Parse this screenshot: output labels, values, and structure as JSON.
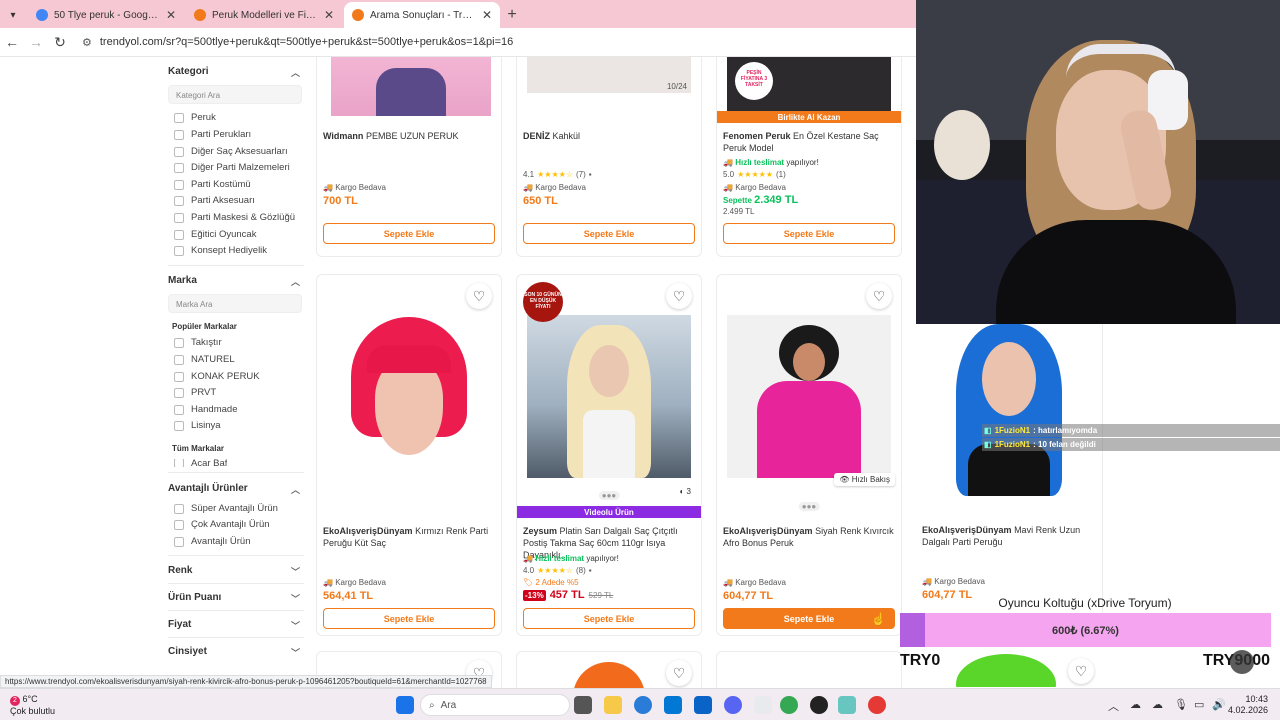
{
  "browser": {
    "tabs": [
      {
        "title": "50 Tlye peruk - Google'da Ara",
        "favicon_color": "#4285f4",
        "active": false
      },
      {
        "title": "Peruk Modelleri ve Fiyatları - Tr",
        "favicon_color": "#f27a1a",
        "active": false
      },
      {
        "title": "Arama Sonuçları - Trendyol",
        "favicon_color": "#f27a1a",
        "active": true
      }
    ],
    "new_tab": "+",
    "url": "trendyol.com/sr?q=500tlye+peruk&qt=500tlye+peruk&st=500tlye+peruk&os=1&pi=16"
  },
  "sidebar": {
    "kategori": {
      "title": "Kategori",
      "search_placeholder": "Kategori Ara",
      "items": [
        "Peruk",
        "Parti Perukları",
        "Diğer Saç Aksesuarları",
        "Diğer Parti Malzemeleri",
        "Parti Kostümü",
        "Parti Aksesuarı",
        "Parti Maskesi & Gözlüğü",
        "Eğitici Oyuncak",
        "Konsept Hediyelik"
      ]
    },
    "marka": {
      "title": "Marka",
      "search_placeholder": "Marka Ara",
      "popular_label": "Popüler Markalar",
      "popular": [
        "Takıştır",
        "NATUREL",
        "KONAK PERUK",
        "PRVT",
        "Handmade",
        "Lisinya"
      ],
      "all_label": "Tüm Markalar",
      "all_partial": "Acar Baf"
    },
    "avantajli": {
      "title": "Avantajlı Ürünler",
      "items": [
        "Süper Avantajlı Ürün",
        "Çok Avantajlı Ürün",
        "Avantajlı Ürün"
      ]
    },
    "collapsed": [
      "Renk",
      "Ürün Puanı",
      "Fiyat",
      "Cinsiyet"
    ]
  },
  "products_row1": [
    {
      "brand": "Widmann",
      "name": "PEMBE UZUN PERUK",
      "shipping": "Kargo Bedava",
      "price": "700 TL",
      "button": "Sepete Ekle"
    },
    {
      "brand": "DENİZ",
      "name": "Kahkül",
      "rating": "4.1",
      "reviews": "(7)",
      "shipping": "Kargo Bedava",
      "price": "650 TL",
      "button": "Sepete Ekle",
      "counter": "10/24"
    },
    {
      "brand": "Fenomen Peruk",
      "name": "En Özel Kestane Saç Peruk Model",
      "band": "Birlikte Al Kazan",
      "fast": "Hızlı teslimat",
      "fast_suffix": "yapılıyor!",
      "rating": "5.0",
      "reviews": "(1)",
      "shipping": "Kargo Bedava",
      "basket_label": "Sepette",
      "price": "2.349 TL",
      "old_price": "2.499 TL",
      "button": "Sepete Ekle",
      "badge": "PEŞİN FİYATINA 3 TAKSİT"
    }
  ],
  "products_row2": [
    {
      "brand": "EkoAlışverişDünyam",
      "name": "Kırmızı Renk Parti Peruğu Küt Saç",
      "shipping": "Kargo Bedava",
      "price": "564,41 TL",
      "button": "Sepete Ekle"
    },
    {
      "brand": "Zeysum",
      "name": "Platin Sarı Dalgalı Saç Çıtçıtlı Postiş Takma Saç 60cm 110gr Isıya Dayanıklı...",
      "band": "Videolu Ürün",
      "fast": "Hızlı teslimat",
      "fast_suffix": "yapılıyor!",
      "rating": "4.0",
      "reviews": "(8)",
      "promo": "2 Adede %5",
      "discount": "-13%",
      "price": "457 TL",
      "old_price": "529 TL",
      "button": "Sepete Ekle",
      "badge": "SON 10 GÜNÜN EN DÜŞÜK FİYATI",
      "img_count": "3"
    },
    {
      "brand": "EkoAlışverişDünyam",
      "name": "Siyah Renk Kıvırcık Afro Bonus Peruk",
      "quick_view": "Hızlı Bakış",
      "shipping": "Kargo Bedava",
      "price": "604,77 TL",
      "button": "Sepete Ekle"
    },
    {
      "brand": "EkoAlışverişDünyam",
      "name": "Mavi Renk Uzun Dalgalı Parti Peruğu",
      "shipping": "Kargo Bedava",
      "price": "604,77 TL"
    }
  ],
  "status_url": "https://www.trendyol.com/ekoalisverisdunyam/siyah-renk-kivircik-afro-bonus-peruk-p-1096461205?boutiqueId=61&merchantId=1027768",
  "stream": {
    "chat": [
      {
        "user": "1FuzioN1",
        "message": ": hatırlamıyomda"
      },
      {
        "user": "1FuzioN1",
        "message": ": 10 felan değildi"
      }
    ],
    "goal_title": "Oyuncu Koltuğu (xDrive Toryum)",
    "goal_text": "600₺ (6.67%)",
    "goal_progress": 0.0667,
    "goal_min": "TRY0",
    "goal_max": "TRY9000"
  },
  "taskbar": {
    "temp": "6°C",
    "weather": "Çok bulutlu",
    "weather_badge": "2",
    "search": "Ara",
    "time": "10:43",
    "date": "4.02.2026"
  }
}
